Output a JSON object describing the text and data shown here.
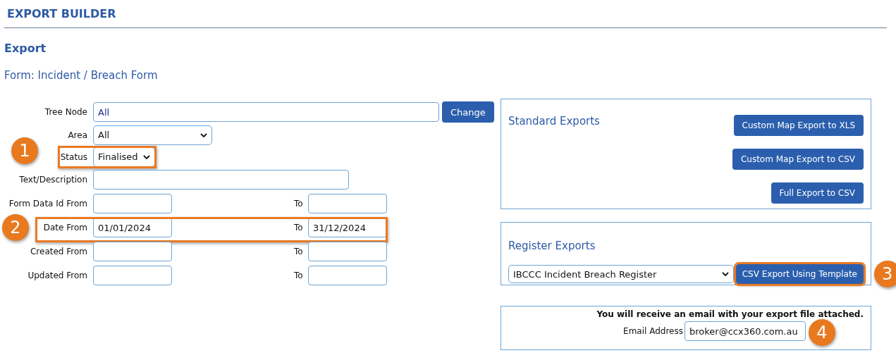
{
  "header": {
    "title": "EXPORT BUILDER"
  },
  "section_title": "Export",
  "form_name": "Form: Incident / Breach Form",
  "fields": [
    {
      "kind": "node",
      "label": "Tree Node",
      "value": "All",
      "button": "Change",
      "highlighted": false
    },
    {
      "kind": "select",
      "label": "Area",
      "value": "All",
      "highlighted": false
    },
    {
      "kind": "select",
      "label": "Status",
      "value": "Finalised",
      "highlighted": true,
      "callout": "1"
    },
    {
      "kind": "text",
      "label": "Text/Description",
      "highlighted": false
    },
    {
      "kind": "range",
      "label": "Form Data Id From",
      "to_label": "To",
      "highlighted": false
    },
    {
      "kind": "range",
      "label": "Date From",
      "value": "01/01/2024",
      "to_label": "To",
      "to_value": "31/12/2024",
      "highlighted": true,
      "callout": "2"
    },
    {
      "kind": "range",
      "label": "Created From",
      "to_label": "To",
      "highlighted": false
    },
    {
      "kind": "range",
      "label": "Updated From",
      "to_label": "To",
      "highlighted": false
    }
  ],
  "standard_exports": {
    "title": "Standard Exports",
    "buttons": [
      "Custom Map Export to XLS",
      "Custom Map Export to CSV",
      "Full Export to CSV"
    ]
  },
  "register_exports": {
    "title": "Register Exports",
    "register": "IBCCC Incident Breach Register",
    "button": {
      "label": "CSV Export Using Template",
      "highlighted": true,
      "callout": "3"
    }
  },
  "email": {
    "notice": "You will receive an email with your export file attached.",
    "label": "Email Address",
    "value": "broker@ccx360.com.au",
    "callout": "4"
  }
}
